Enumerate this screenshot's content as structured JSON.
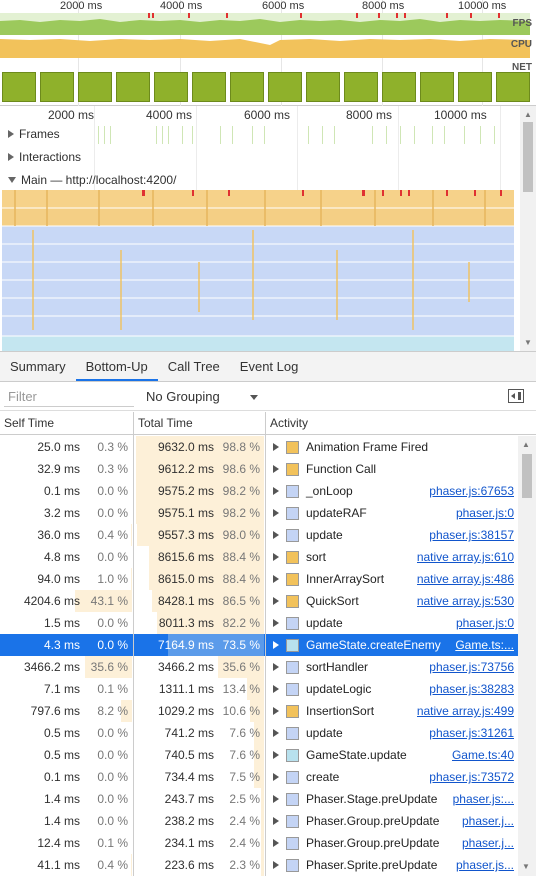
{
  "overview": {
    "ticks": [
      "2000 ms",
      "4000 ms",
      "6000 ms",
      "8000 ms",
      "10000 ms"
    ],
    "labels": {
      "fps": "FPS",
      "cpu": "CPU",
      "net": "NET"
    },
    "colors": {
      "fps": "#8fbe4e",
      "fps_drop": "#e03131",
      "cpu": "#f2c25b",
      "net": "#8fb12b"
    }
  },
  "timeline": {
    "ticks": [
      "2000 ms",
      "4000 ms",
      "6000 ms",
      "8000 ms",
      "10000 ms"
    ],
    "tracks": {
      "frames": "Frames",
      "interactions": "Interactions",
      "main": "Main — http://localhost:4200/"
    }
  },
  "tabs": [
    "Summary",
    "Bottom-Up",
    "Call Tree",
    "Event Log"
  ],
  "active_tab": "Bottom-Up",
  "toolbar": {
    "filter_placeholder": "Filter",
    "grouping": "No Grouping",
    "sidebar_toggle_icon": "sidebar-toggle-icon"
  },
  "columns": {
    "self": "Self Time",
    "total": "Total Time",
    "activity": "Activity"
  },
  "colors": {
    "scripting": "#f2c25b",
    "rendering": "#c4d4f5",
    "other": "#b8e1ee",
    "selected": "#1a73e8"
  },
  "rows": [
    {
      "self_ms": "25.0 ms",
      "self_pct": "0.3 %",
      "self_frac": 0.003,
      "total_ms": "9632.0 ms",
      "total_pct": "98.8 %",
      "total_frac": 0.988,
      "name": "Animation Frame Fired",
      "kind": "scripting",
      "link": ""
    },
    {
      "self_ms": "32.9 ms",
      "self_pct": "0.3 %",
      "self_frac": 0.003,
      "total_ms": "9612.2 ms",
      "total_pct": "98.6 %",
      "total_frac": 0.986,
      "name": "Function Call",
      "kind": "scripting",
      "link": ""
    },
    {
      "self_ms": "0.1 ms",
      "self_pct": "0.0 %",
      "self_frac": 0.0,
      "total_ms": "9575.2 ms",
      "total_pct": "98.2 %",
      "total_frac": 0.982,
      "name": "_onLoop",
      "kind": "rendering",
      "link": "phaser.js:67653"
    },
    {
      "self_ms": "3.2 ms",
      "self_pct": "0.0 %",
      "self_frac": 0.0,
      "total_ms": "9575.1 ms",
      "total_pct": "98.2 %",
      "total_frac": 0.982,
      "name": "updateRAF",
      "kind": "rendering",
      "link": "phaser.js:0"
    },
    {
      "self_ms": "36.0 ms",
      "self_pct": "0.4 %",
      "self_frac": 0.004,
      "total_ms": "9557.3 ms",
      "total_pct": "98.0 %",
      "total_frac": 0.98,
      "name": "update",
      "kind": "rendering",
      "link": "phaser.js:38157"
    },
    {
      "self_ms": "4.8 ms",
      "self_pct": "0.0 %",
      "self_frac": 0.0,
      "total_ms": "8615.6 ms",
      "total_pct": "88.4 %",
      "total_frac": 0.884,
      "name": "sort",
      "kind": "scripting",
      "link": "native array.js:610"
    },
    {
      "self_ms": "94.0 ms",
      "self_pct": "1.0 %",
      "self_frac": 0.01,
      "total_ms": "8615.0 ms",
      "total_pct": "88.4 %",
      "total_frac": 0.884,
      "name": "InnerArraySort",
      "kind": "scripting",
      "link": "native array.js:486"
    },
    {
      "self_ms": "4204.6 ms",
      "self_pct": "43.1 %",
      "self_frac": 0.431,
      "total_ms": "8428.1 ms",
      "total_pct": "86.5 %",
      "total_frac": 0.865,
      "name": "QuickSort",
      "kind": "scripting",
      "link": "native array.js:530"
    },
    {
      "self_ms": "1.5 ms",
      "self_pct": "0.0 %",
      "self_frac": 0.0,
      "total_ms": "8011.3 ms",
      "total_pct": "82.2 %",
      "total_frac": 0.822,
      "name": "update",
      "kind": "rendering",
      "link": "phaser.js:0"
    },
    {
      "self_ms": "4.3 ms",
      "self_pct": "0.0 %",
      "self_frac": 0.0,
      "total_ms": "7164.9 ms",
      "total_pct": "73.5 %",
      "total_frac": 0.735,
      "name": "GameState.createEnemy",
      "kind": "other",
      "link": "Game.ts:...",
      "selected": true
    },
    {
      "self_ms": "3466.2 ms",
      "self_pct": "35.6 %",
      "self_frac": 0.356,
      "total_ms": "3466.2 ms",
      "total_pct": "35.6 %",
      "total_frac": 0.356,
      "name": "sortHandler",
      "kind": "rendering",
      "link": "phaser.js:73756"
    },
    {
      "self_ms": "7.1 ms",
      "self_pct": "0.1 %",
      "self_frac": 0.001,
      "total_ms": "1311.1 ms",
      "total_pct": "13.4 %",
      "total_frac": 0.134,
      "name": "updateLogic",
      "kind": "rendering",
      "link": "phaser.js:38283"
    },
    {
      "self_ms": "797.6 ms",
      "self_pct": "8.2 %",
      "self_frac": 0.082,
      "total_ms": "1029.2 ms",
      "total_pct": "10.6 %",
      "total_frac": 0.106,
      "name": "InsertionSort",
      "kind": "scripting",
      "link": "native array.js:499"
    },
    {
      "self_ms": "0.5 ms",
      "self_pct": "0.0 %",
      "self_frac": 0.0,
      "total_ms": "741.2 ms",
      "total_pct": "7.6 %",
      "total_frac": 0.076,
      "name": "update",
      "kind": "rendering",
      "link": "phaser.js:31261"
    },
    {
      "self_ms": "0.5 ms",
      "self_pct": "0.0 %",
      "self_frac": 0.0,
      "total_ms": "740.5 ms",
      "total_pct": "7.6 %",
      "total_frac": 0.076,
      "name": "GameState.update",
      "kind": "other",
      "link": "Game.ts:40"
    },
    {
      "self_ms": "0.1 ms",
      "self_pct": "0.0 %",
      "self_frac": 0.0,
      "total_ms": "734.4 ms",
      "total_pct": "7.5 %",
      "total_frac": 0.075,
      "name": "create",
      "kind": "rendering",
      "link": "phaser.js:73572"
    },
    {
      "self_ms": "1.4 ms",
      "self_pct": "0.0 %",
      "self_frac": 0.0,
      "total_ms": "243.7 ms",
      "total_pct": "2.5 %",
      "total_frac": 0.025,
      "name": "Phaser.Stage.preUpdate",
      "kind": "rendering",
      "link": "phaser.js:..."
    },
    {
      "self_ms": "1.4 ms",
      "self_pct": "0.0 %",
      "self_frac": 0.0,
      "total_ms": "238.2 ms",
      "total_pct": "2.4 %",
      "total_frac": 0.024,
      "name": "Phaser.Group.preUpdate",
      "kind": "rendering",
      "link": "phaser.j..."
    },
    {
      "self_ms": "12.4 ms",
      "self_pct": "0.1 %",
      "self_frac": 0.001,
      "total_ms": "234.1 ms",
      "total_pct": "2.4 %",
      "total_frac": 0.024,
      "name": "Phaser.Group.preUpdate",
      "kind": "rendering",
      "link": "phaser.j..."
    },
    {
      "self_ms": "41.1 ms",
      "self_pct": "0.4 %",
      "self_frac": 0.004,
      "total_ms": "223.6 ms",
      "total_pct": "2.3 %",
      "total_frac": 0.023,
      "name": "Phaser.Sprite.preUpdate",
      "kind": "rendering",
      "link": "phaser.js..."
    }
  ]
}
